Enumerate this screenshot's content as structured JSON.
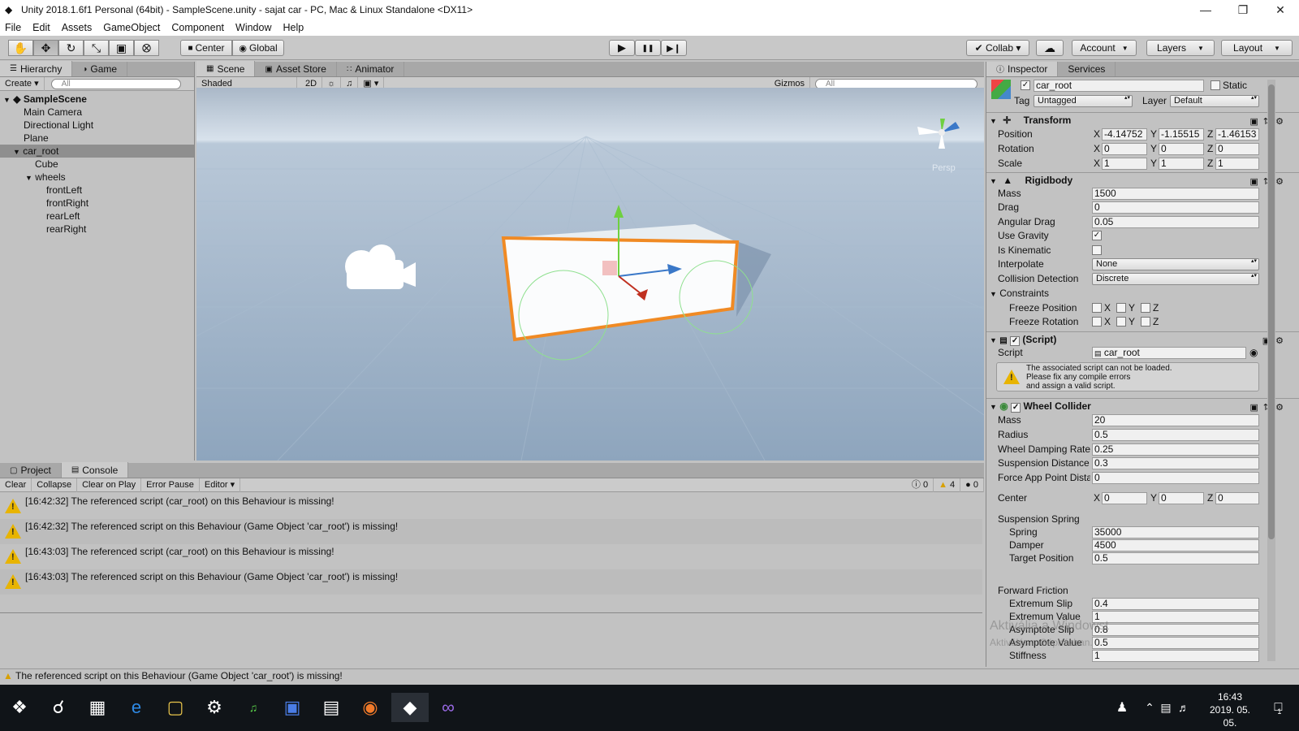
{
  "window": {
    "title": "Unity 2018.1.6f1 Personal (64bit) - SampleScene.unity - sajat car - PC, Mac & Linux Standalone <DX11>",
    "minimize": "—",
    "maximize": "❐",
    "close": "✕"
  },
  "menu": [
    "File",
    "Edit",
    "Assets",
    "GameObject",
    "Component",
    "Window",
    "Help"
  ],
  "toolbar": {
    "tools": [
      "✋",
      "✥",
      "↻",
      "⤡",
      "▣",
      "⭙"
    ],
    "center": "Center",
    "global": "Global",
    "play": "▶",
    "pause": "❚❚",
    "step": "▶❙",
    "collab": "✔ Collab ▾",
    "cloud": "☁",
    "account": "Account",
    "layers": "Layers",
    "layout": "Layout"
  },
  "hierarchy": {
    "tabs": [
      "Hierarchy",
      "Game"
    ],
    "create": "Create ▾",
    "search": "All",
    "scene": "SampleScene",
    "items": [
      {
        "label": "Main Camera",
        "indent": 1
      },
      {
        "label": "Directional Light",
        "indent": 1
      },
      {
        "label": "Plane",
        "indent": 1
      },
      {
        "label": "car_root",
        "indent": 1,
        "selected": true
      },
      {
        "label": "Cube",
        "indent": 2
      },
      {
        "label": "wheels",
        "indent": 2
      },
      {
        "label": "frontLeft",
        "indent": 3
      },
      {
        "label": "frontRight",
        "indent": 3
      },
      {
        "label": "rearLeft",
        "indent": 3
      },
      {
        "label": "rearRight",
        "indent": 3
      }
    ]
  },
  "scene": {
    "tabs": [
      "Scene",
      "Asset Store",
      "Animator"
    ],
    "shaded": "Shaded",
    "twod": "2D",
    "gizmos": "Gizmos",
    "search": "All",
    "persp": "Persp"
  },
  "console": {
    "tabs": [
      "Project",
      "Console"
    ],
    "buttons": [
      "Clear",
      "Collapse",
      "Clear on Play",
      "Error Pause",
      "Editor"
    ],
    "counts": [
      "0",
      "4",
      "0"
    ],
    "messages": [
      "[16:42:32] The referenced script (car_root) on this Behaviour is missing!",
      "[16:42:32] The referenced script on this Behaviour (Game Object 'car_root') is missing!",
      "[16:43:03] The referenced script (car_root) on this Behaviour is missing!",
      "[16:43:03] The referenced script on this Behaviour (Game Object 'car_root') is missing!"
    ]
  },
  "inspector": {
    "tabs": [
      "Inspector",
      "Services"
    ],
    "name": "car_root",
    "static": "Static",
    "tag_label": "Tag",
    "tag": "Untagged",
    "layer_label": "Layer",
    "layer": "Default",
    "transform": {
      "title": "Transform",
      "rows": [
        {
          "label": "Position",
          "x": "-4.14752",
          "y": "-1.15515",
          "z": "-1.46153"
        },
        {
          "label": "Rotation",
          "x": "0",
          "y": "0",
          "z": "0"
        },
        {
          "label": "Scale",
          "x": "1",
          "y": "1",
          "z": "1"
        }
      ]
    },
    "rigidbody": {
      "title": "Rigidbody",
      "mass_label": "Mass",
      "mass": "1500",
      "drag_label": "Drag",
      "drag": "0",
      "adrag_label": "Angular Drag",
      "adrag": "0.05",
      "gravity_label": "Use Gravity",
      "kinematic_label": "Is Kinematic",
      "interp_label": "Interpolate",
      "interp": "None",
      "coll_label": "Collision Detection",
      "coll": "Discrete",
      "constraints": "Constraints",
      "fpos": "Freeze Position",
      "frot": "Freeze Rotation"
    },
    "script": {
      "title": "(Script)",
      "label": "Script",
      "value": "car_root",
      "warning": [
        "The associated script can not be loaded.",
        "Please fix any compile errors",
        "and assign a valid script."
      ]
    },
    "wheel": {
      "title": "Wheel Collider",
      "rows": [
        {
          "label": "Mass",
          "value": "20"
        },
        {
          "label": "Radius",
          "value": "0.5"
        },
        {
          "label": "Wheel Damping Rate",
          "value": "0.25"
        },
        {
          "label": "Suspension Distance",
          "value": "0.3"
        },
        {
          "label": "Force App Point Dista",
          "value": "0"
        }
      ],
      "center_label": "Center",
      "center": {
        "x": "0",
        "y": "0",
        "z": "0"
      },
      "spring_title": "Suspension Spring",
      "spring_rows": [
        {
          "label": "Spring",
          "value": "35000"
        },
        {
          "label": "Damper",
          "value": "4500"
        },
        {
          "label": "Target Position",
          "value": "0.5"
        }
      ],
      "friction_title": "Forward Friction",
      "friction_rows": [
        {
          "label": "Extremum Slip",
          "value": "0.4"
        },
        {
          "label": "Extremum Value",
          "value": "1"
        },
        {
          "label": "Asymptote Slip",
          "value": "0.8"
        },
        {
          "label": "Asymptote Value",
          "value": "0.5"
        },
        {
          "label": "Stiffness",
          "value": "1"
        }
      ]
    },
    "watermark1": "Aktiválja a Windowst",
    "watermark2": "Aktiválás a Gépházban."
  },
  "statusbar": "The referenced script on this Behaviour (Game Object 'car_root') is missing!",
  "taskbar": {
    "time": "16:43",
    "date": "2019. 05. 05.",
    "notif": "1"
  },
  "colors": {
    "selection": "#f08a24",
    "accent": "#3a78c8"
  }
}
